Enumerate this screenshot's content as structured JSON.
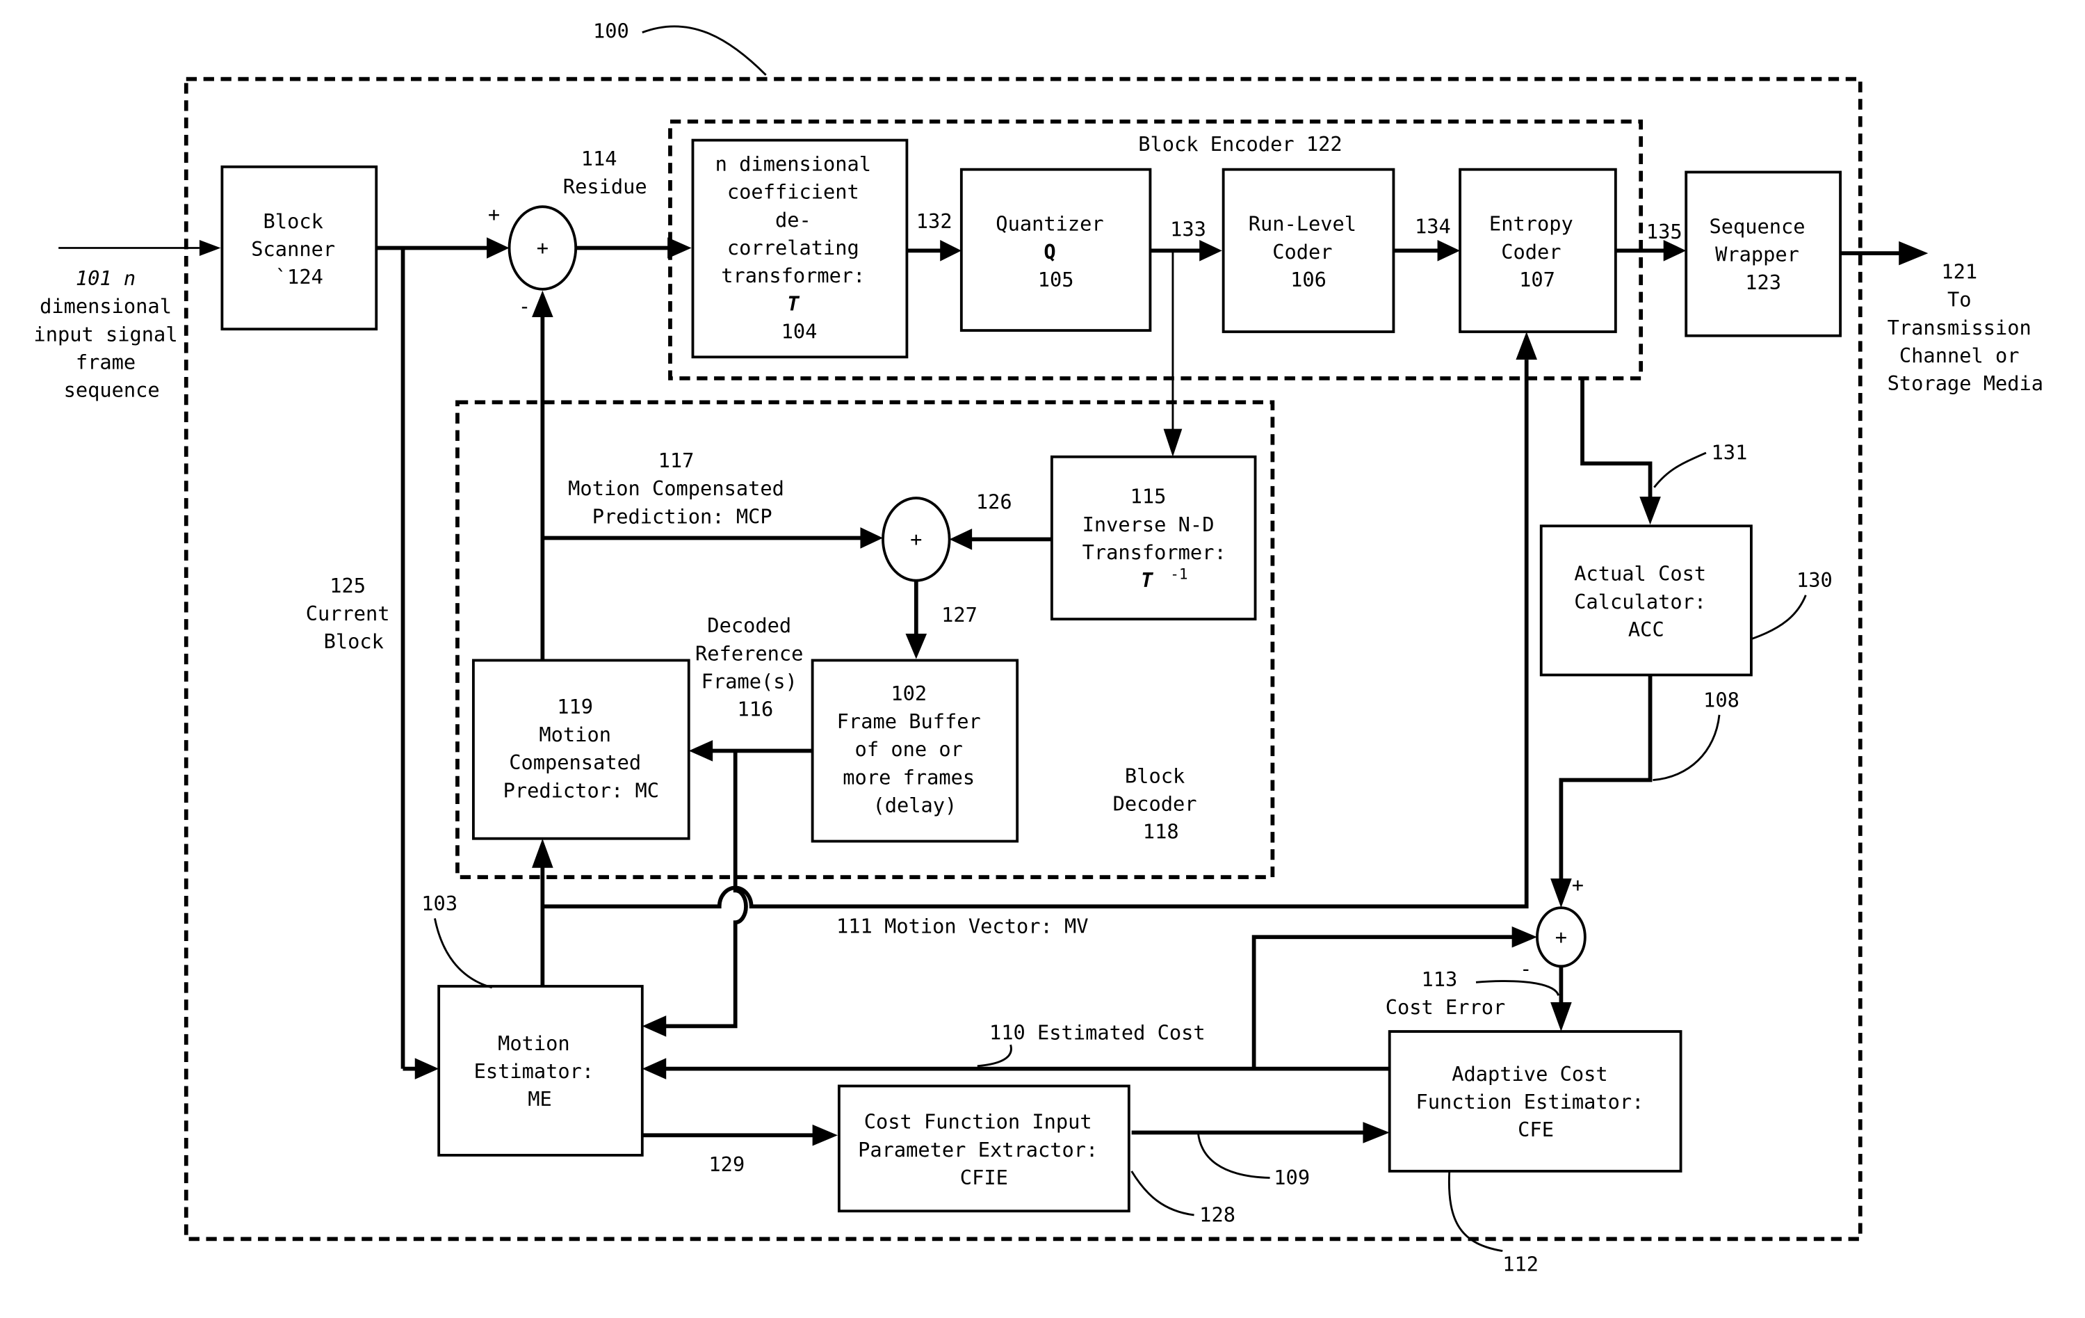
{
  "figure": {
    "system_ref": "100",
    "input": {
      "lines": [
        "101 n",
        "dimensional",
        "input signal",
        "frame",
        "sequence"
      ]
    },
    "output": {
      "lines": [
        "121",
        "To",
        "Transmission",
        "Channel or",
        "Storage Media"
      ]
    },
    "blocks": {
      "block_scanner": {
        "lines": [
          "Block",
          "Scanner",
          "`124"
        ]
      },
      "transformer": {
        "lines": [
          "n dimensional",
          "coefficient",
          "de-",
          "correlating",
          "transformer:",
          "T",
          "104"
        ]
      },
      "quantizer": {
        "lines": [
          "Quantizer",
          "Q",
          "105"
        ]
      },
      "run_level": {
        "lines": [
          "Run-Level",
          "Coder",
          "106"
        ]
      },
      "entropy": {
        "lines": [
          "Entropy",
          "Coder",
          "107"
        ]
      },
      "sequence_wrapper": {
        "lines": [
          "Sequence",
          "Wrapper",
          "123"
        ]
      },
      "inverse_transformer": {
        "lines": [
          "115",
          "Inverse N-D",
          "Transformer:",
          "T",
          "-1"
        ]
      },
      "frame_buffer": {
        "lines": [
          "102",
          "Frame Buffer",
          "of one or",
          "more frames",
          "(delay)"
        ]
      },
      "mc_predictor": {
        "lines": [
          "119",
          "Motion",
          "Compensated",
          "Predictor: MC"
        ]
      },
      "motion_estimator": {
        "lines": [
          "Motion",
          "Estimator:",
          "ME"
        ]
      },
      "cfie": {
        "lines": [
          "Cost Function Input",
          "Parameter Extractor:",
          "CFIE"
        ]
      },
      "cfe": {
        "lines": [
          "Adaptive Cost",
          "Function Estimator:",
          "CFE"
        ]
      },
      "acc": {
        "lines": [
          "Actual Cost",
          "Calculator:",
          "ACC"
        ]
      }
    },
    "groups": {
      "block_encoder": "Block Encoder 122",
      "block_decoder": [
        "Block",
        "Decoder",
        "118"
      ]
    },
    "signals": {
      "residue": [
        "114",
        "Residue"
      ],
      "s132": "132",
      "s133": "133",
      "s134": "134",
      "s135": "135",
      "mcp": [
        "117",
        "Motion Compensated",
        "Prediction: MCP"
      ],
      "s126": "126",
      "s127": "127",
      "decoded_ref": [
        "Decoded",
        "Reference",
        "Frame(s)",
        "116"
      ],
      "current_block": [
        "125",
        "Current",
        "Block"
      ],
      "motion_vector": "111 Motion Vector: MV",
      "estimated_cost": "110 Estimated Cost",
      "cost_error": [
        "113",
        "Cost Error"
      ],
      "s129": "129",
      "s109": "109",
      "s108": "108",
      "s131": "131",
      "s130": "130",
      "s128": "128",
      "s112": "112",
      "s103": "103"
    },
    "sum_signs": {
      "plus": "+",
      "minus": "-"
    }
  }
}
